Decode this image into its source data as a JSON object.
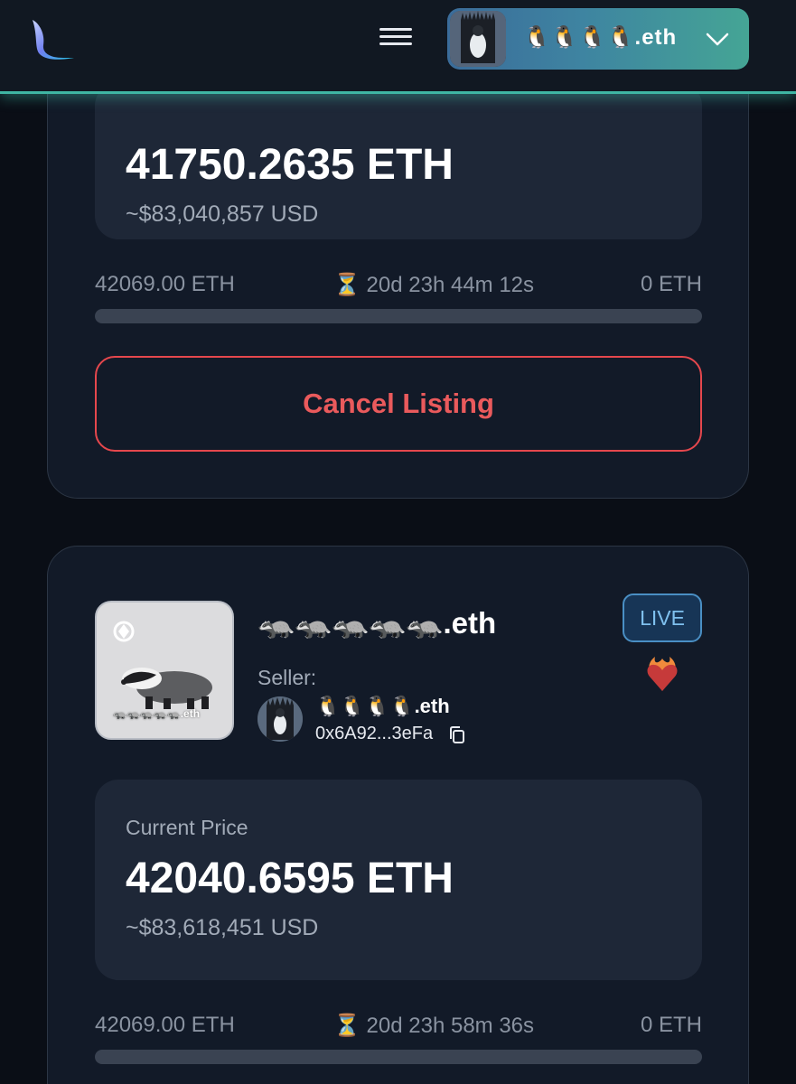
{
  "header": {
    "account_name": "🐧🐧🐧🐧.eth"
  },
  "listings": [
    {
      "price_eth": "41750.2635 ETH",
      "price_usd": "~$83,040,857 USD",
      "start_price": "42069.00 ETH",
      "timer": "⏳ 20d 23h 44m 12s",
      "end_price": "0 ETH",
      "cancel_label": "Cancel Listing"
    },
    {
      "name": "🦡🦡🦡🦡🦡.eth",
      "status": "LIVE",
      "seller_label": "Seller:",
      "seller_name": "🐧🐧🐧🐧.eth",
      "seller_address": "0x6A92...3eFa",
      "thumb_caption": "🦡🦡🦡🦡🦡.eth",
      "price_label": "Current Price",
      "price_eth": "42040.6595 ETH",
      "price_usd": "~$83,618,451 USD",
      "start_price": "42069.00 ETH",
      "timer": "⏳ 20d 23h 58m 36s",
      "end_price": "0 ETH"
    }
  ],
  "colors": {
    "accent": "#3fb5a3",
    "danger": "#e5474d",
    "live": "#4a8fc4"
  }
}
